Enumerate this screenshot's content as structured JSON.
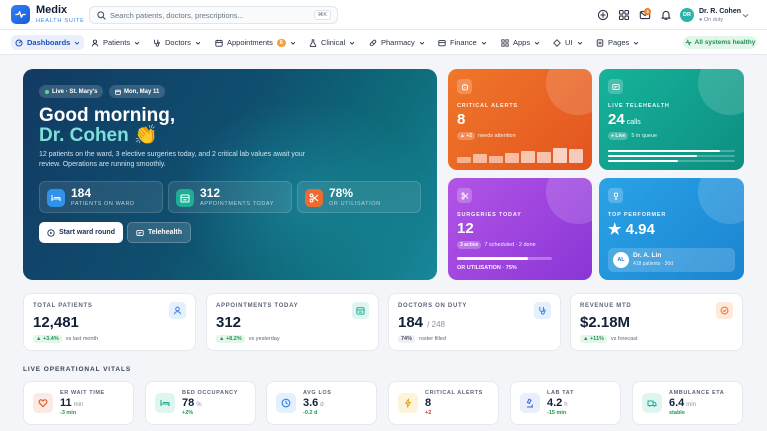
{
  "app": {
    "name": "Medix",
    "subtitle": "HEALTH SUITE"
  },
  "search": {
    "placeholder": "Search patients, doctors, prescriptions...",
    "shortcut": "⌘K"
  },
  "notifications": {
    "badge_count": "3"
  },
  "user": {
    "initials": "DR",
    "name": "Dr. R. Cohen",
    "status": "● On duty"
  },
  "nav": {
    "items": [
      {
        "label": "Dashboards",
        "active": true
      },
      {
        "label": "Patients"
      },
      {
        "label": "Doctors"
      },
      {
        "label": "Appointments",
        "count": "6"
      },
      {
        "label": "Clinical"
      },
      {
        "label": "Pharmacy"
      },
      {
        "label": "Finance"
      },
      {
        "label": "Apps"
      },
      {
        "label": "UI"
      },
      {
        "label": "Pages"
      }
    ],
    "system_status": "All systems healthy"
  },
  "hero": {
    "location": "Live · St. Mary's",
    "date": "Mon, May 11",
    "greeting": "Good morning,",
    "name": "Dr. Cohen 👏",
    "description": "12 patients on the ward, 3 elective surgeries today, and 2 critical lab values await your review. Operations are running smoothly.",
    "stats": [
      {
        "value": "184",
        "label": "PATIENTS ON WARD"
      },
      {
        "value": "312",
        "label": "APPOINTMENTS TODAY"
      },
      {
        "value": "78%",
        "label": "OR UTILISATION"
      }
    ],
    "primary_button": "Start ward round",
    "secondary_button": "Telehealth"
  },
  "tiles": {
    "critical": {
      "label": "CRITICAL ALERTS",
      "value": "8",
      "chip": "▲ +2",
      "sub": "needs attention",
      "bars": [
        0.35,
        0.55,
        0.45,
        0.6,
        0.75,
        0.7,
        0.95,
        0.85
      ]
    },
    "telehealth": {
      "label": "LIVE TELEHEALTH",
      "value": "24",
      "unit": "calls",
      "chip": "● Live",
      "sub": "5 in queue",
      "progress": [
        0.88,
        0.7,
        0.55
      ]
    },
    "surgeries": {
      "label": "SURGERIES TODAY",
      "value": "12",
      "chip": "3 active",
      "sub": "7 scheduled · 2 done",
      "footer": "OR UTILISATION · 75%",
      "or_util": 0.75
    },
    "performer": {
      "label": "TOP PERFORMER",
      "value": "★ 4.94",
      "initials": "AL",
      "name": "Dr. A. Lin",
      "detail": "418 patients · 30d"
    }
  },
  "kpis": [
    {
      "label": "TOTAL PATIENTS",
      "value": "12,481",
      "suffix": "",
      "delta": "▲ +3.4%",
      "note": "vs last month"
    },
    {
      "label": "APPOINTMENTS TODAY",
      "value": "312",
      "suffix": "",
      "delta": "▲ +8.2%",
      "note": "vs yesterday"
    },
    {
      "label": "DOCTORS ON DUTY",
      "value": "184",
      "suffix": "/ 248",
      "delta": "74%",
      "note": "roster filled"
    },
    {
      "label": "REVENUE MTD",
      "value": "$2.18M",
      "suffix": "",
      "delta": "▲ +11%",
      "note": "vs forecast"
    }
  ],
  "vitals": {
    "title": "LIVE OPERATIONAL VITALS",
    "items": [
      {
        "label": "ER WAIT TIME",
        "value": "11",
        "unit": "min",
        "delta": "-3 min"
      },
      {
        "label": "BED OCCUPANCY",
        "value": "78",
        "unit": "%",
        "delta": "+2%"
      },
      {
        "label": "AVG LOS",
        "value": "3.6",
        "unit": "d",
        "delta": "-0.2 d"
      },
      {
        "label": "CRITICAL ALERTS",
        "value": "8",
        "unit": "",
        "delta": "+2"
      },
      {
        "label": "LAB TAT",
        "value": "4.2",
        "unit": "h",
        "delta": "-15 min"
      },
      {
        "label": "AMBULANCE ETA",
        "value": "6.4",
        "unit": "min",
        "delta": "stable"
      }
    ]
  },
  "colors": {
    "accent": "#2f7ef6",
    "success": "#23965a",
    "danger": "#d6322e"
  }
}
